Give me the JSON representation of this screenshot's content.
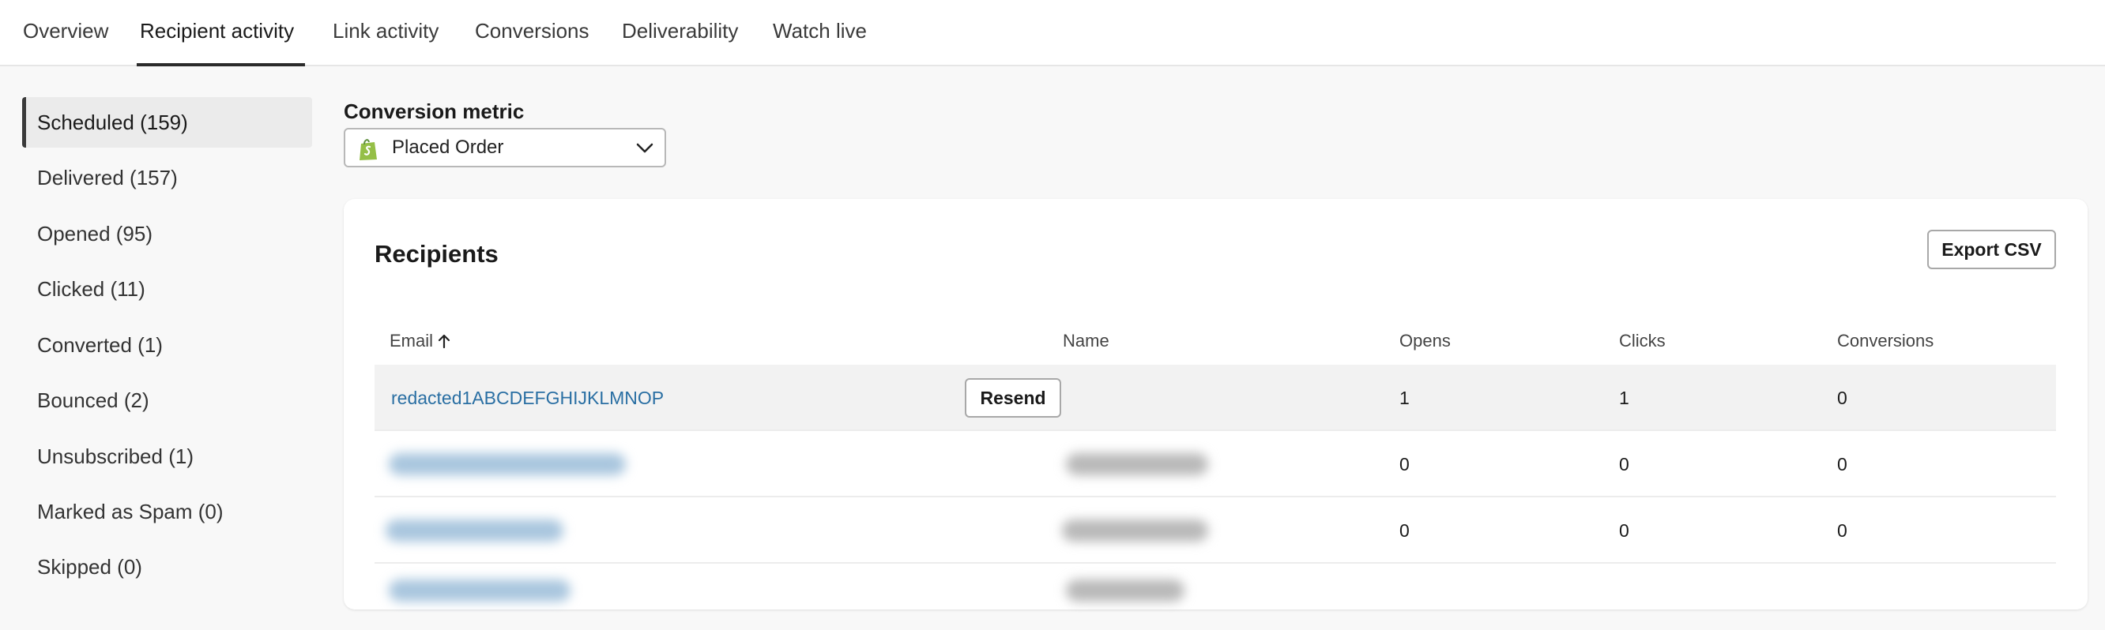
{
  "tabs": [
    {
      "label": "Overview",
      "active": false
    },
    {
      "label": "Recipient activity",
      "active": true
    },
    {
      "label": "Link activity",
      "active": false
    },
    {
      "label": "Conversions",
      "active": false
    },
    {
      "label": "Deliverability",
      "active": false
    },
    {
      "label": "Watch live",
      "active": false
    }
  ],
  "sidebar": {
    "items": [
      {
        "label": "Scheduled (159)",
        "active": true
      },
      {
        "label": "Delivered (157)",
        "active": false
      },
      {
        "label": "Opened (95)",
        "active": false
      },
      {
        "label": "Clicked (11)",
        "active": false
      },
      {
        "label": "Converted (1)",
        "active": false
      },
      {
        "label": "Bounced (2)",
        "active": false
      },
      {
        "label": "Unsubscribed (1)",
        "active": false
      },
      {
        "label": "Marked as Spam (0)",
        "active": false
      },
      {
        "label": "Skipped (0)",
        "active": false
      }
    ]
  },
  "metric": {
    "label": "Conversion metric",
    "value": "Placed Order",
    "icon": "shopify-bag-icon"
  },
  "recipients": {
    "title": "Recipients",
    "export_label": "Export CSV",
    "columns": {
      "email": "Email",
      "name": "Name",
      "opens": "Opens",
      "clicks": "Clicks",
      "conversions": "Conversions"
    },
    "sort_icon": "arrow-up-icon",
    "resend_label": "Resend",
    "rows": [
      {
        "email": "redacted1ABCDEFGHIJKLMNOP",
        "name": "",
        "opens": "1",
        "clicks": "1",
        "conversions": "0",
        "redacted": false
      },
      {
        "email": "",
        "name": "",
        "opens": "0",
        "clicks": "0",
        "conversions": "0",
        "redacted": true
      },
      {
        "email": "",
        "name": "",
        "opens": "0",
        "clicks": "0",
        "conversions": "0",
        "redacted": true
      }
    ]
  },
  "colors": {
    "link": "#2a6fa3",
    "shopify_green": "#95bf47",
    "active_border": "#3a3a3a"
  }
}
